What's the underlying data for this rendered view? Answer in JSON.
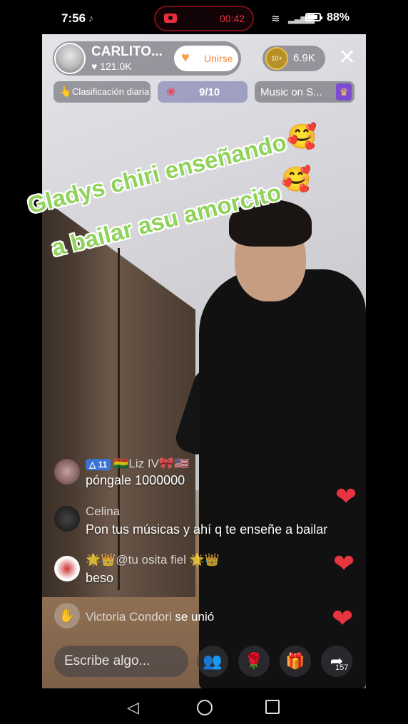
{
  "status_bar": {
    "time": "7:56",
    "recording_time": "00:42",
    "battery": "88%"
  },
  "live": {
    "host_name": "CARLITO...",
    "host_likes": "♥ 121.0K",
    "join_button": "Unirse",
    "viewer_badge": "10+",
    "viewer_count": "6.9K",
    "ranking_label": "Clasificación diaria",
    "goal_progress": "9/10",
    "music_label": "Music on S..."
  },
  "caption": {
    "line1": "Gladys chiri enseñando",
    "line2": "a bailar asu amorcito",
    "emoji": "🥰"
  },
  "comments": [
    {
      "badge": "△ 11",
      "name": "🇧🇴Liz IV🎀🇺🇸",
      "text": "póngale 1000000"
    },
    {
      "name": "Celina",
      "text": "Pon tus músicas y ahí q te enseñe a bailar"
    },
    {
      "name": "🌟👑@tu osita fiel 🌟👑",
      "text": "beso"
    }
  ],
  "join_event": {
    "user": "Victoria Condori",
    "action": "se unió"
  },
  "bottom_bar": {
    "input_placeholder": "Escribe algo...",
    "share_count": "157"
  },
  "colors": {
    "heart": "#e8343f",
    "caption_green": "#8fd35a",
    "join_orange": "#f28a3c",
    "record_red": "#e8303c"
  }
}
